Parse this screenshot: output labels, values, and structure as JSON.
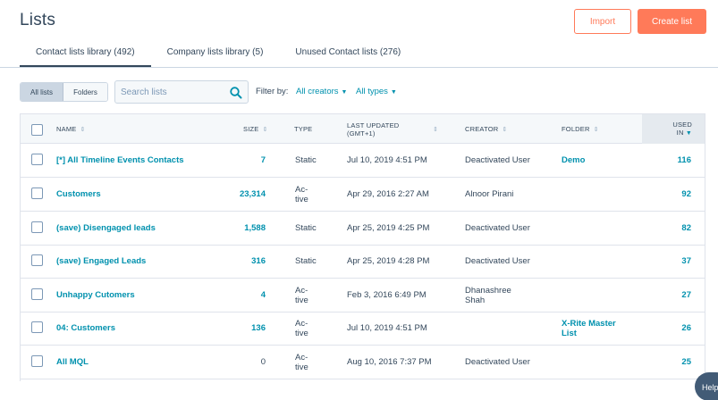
{
  "header": {
    "title": "Lists",
    "import_label": "Import",
    "create_label": "Create list"
  },
  "tabs": [
    {
      "label": "Contact lists library (492)",
      "active": true
    },
    {
      "label": "Company lists library (5)",
      "active": false
    },
    {
      "label": "Unused Contact lists (276)",
      "active": false
    }
  ],
  "filters": {
    "toggle": [
      "All lists",
      "Folders"
    ],
    "search_placeholder": "Search lists",
    "filter_by_label": "Filter by:",
    "creators_label": "All creators",
    "types_label": "All types"
  },
  "table": {
    "columns": {
      "name": "NAME",
      "size": "SIZE",
      "type": "TYPE",
      "updated_line1": "LAST UPDATED",
      "updated_line2": "(GMT+1)",
      "creator": "CREATOR",
      "folder": "FOLDER",
      "used_line1": "USED",
      "used_line2": "IN"
    },
    "rows": [
      {
        "name": "[*] All Timeline Events Contacts",
        "size": "7",
        "type": "Static",
        "updated": "Jul 10, 2019 4:51 PM",
        "creator": "Deactivated User",
        "folder": "Demo",
        "used": "116"
      },
      {
        "name": "Customers",
        "size": "23,314",
        "type": "Ac-\ntive",
        "updated": "Apr 29, 2016 2:27 AM",
        "creator": "Alnoor Pirani",
        "folder": "",
        "used": "92"
      },
      {
        "name": "(save) Disengaged leads",
        "size": "1,588",
        "type": "Static",
        "updated": "Apr 25, 2019 4:25 PM",
        "creator": "Deactivated User",
        "folder": "",
        "used": "82"
      },
      {
        "name": "(save) Engaged Leads",
        "size": "316",
        "type": "Static",
        "updated": "Apr 25, 2019 4:28 PM",
        "creator": "Deactivated User",
        "folder": "",
        "used": "37"
      },
      {
        "name": "Unhappy Cutomers",
        "size": "4",
        "type": "Ac-\ntive",
        "updated": "Feb 3, 2016 6:49 PM",
        "creator": "Dhanashree\nShah",
        "folder": "",
        "used": "27"
      },
      {
        "name": "04: Customers",
        "size": "136",
        "type": "Ac-\ntive",
        "updated": "Jul 10, 2019 4:51 PM",
        "creator": "",
        "folder": "X-Rite Master\nList",
        "used": "26"
      },
      {
        "name": "All MQL",
        "size": "0",
        "type": "Ac-\ntive",
        "updated": "Aug 10, 2016 7:37 PM",
        "creator": "Deactivated User",
        "folder": "",
        "used": "25"
      }
    ]
  },
  "help": {
    "label": "Help"
  },
  "colors": {
    "accent": "#ff7a59",
    "link": "#0091ae",
    "text": "#33475b",
    "border": "#cbd6e2"
  }
}
